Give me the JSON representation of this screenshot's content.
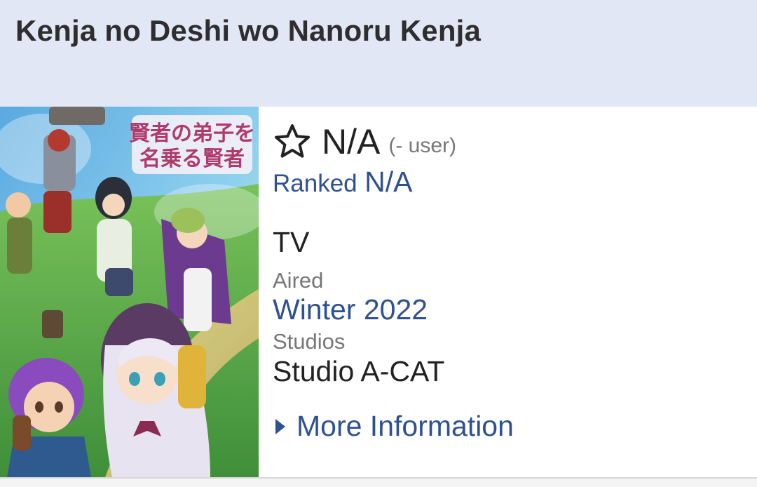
{
  "anime": {
    "title": "Kenja no Deshi wo Nanoru Kenja",
    "cover_logo_text": "賢者の弟子を名乗る賢者",
    "score": {
      "value": "N/A",
      "users": "(- user)"
    },
    "ranked": {
      "label": "Ranked",
      "value": "N/A"
    },
    "type": "TV",
    "aired": {
      "label": "Aired",
      "value": "Winter 2022"
    },
    "studios": {
      "label": "Studios",
      "value": "Studio A-CAT"
    },
    "more_information": "More Information"
  },
  "icons": {
    "score": "star-outline-icon",
    "more": "caret-right-icon"
  },
  "colors": {
    "header_bg": "#e1e7f5",
    "link": "#2e5190",
    "title": "#2e2e2e",
    "muted": "#777777"
  }
}
